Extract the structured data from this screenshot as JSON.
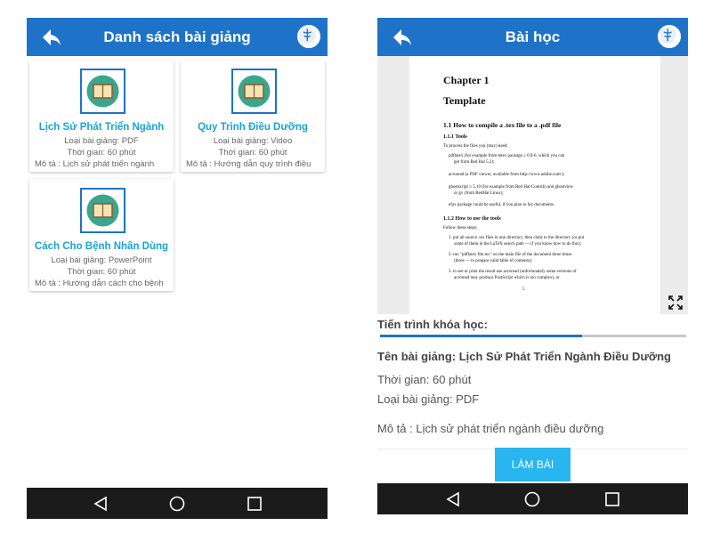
{
  "left_screen": {
    "title": "Danh sách bài giảng",
    "cards": [
      {
        "title": "Lịch Sử Phát Triển Ngành",
        "type": "Loại bài giảng: PDF",
        "duration": "Thời gian: 60 phút",
        "description": "Mô tả : Lịch sử phát triển ngành"
      },
      {
        "title": "Quy Trình Điều Dưỡng",
        "type": "Loại bài giảng: Video",
        "duration": "Thời gian: 60 phút",
        "description": "Mô tả : Hướng dẫn quy trình điều"
      },
      {
        "title": "Cách Cho Bệnh Nhân Dùng",
        "type": "Loại bài giảng: PowerPoint",
        "duration": "Thời gian: 60 phút",
        "description": "Mô tả : Hướng dẫn cách cho bệnh"
      }
    ]
  },
  "right_screen": {
    "title": "Bài học",
    "document": {
      "chapter": "Chapter 1",
      "heading": "Template",
      "section": "1.1   How to compile a .tex file to a .pdf file",
      "subsection1": "1.1.1   Tools",
      "intro": "To process the files you (may) need:",
      "tools": [
        "pdflatex (for example from tetex package ≥ 0.9-6, which you can",
        "get from Red Hat 5.2);",
        "acroread (a PDF viewer, available from http://www.adobe.com/);",
        "ghostscript ≥ 5.10 (for example from Red Hat Contrib) and ghostview",
        "or gv (from RedHat Linux);",
        "efax package could be useful, if you plan to fax documents."
      ],
      "subsection2": "1.1.2   How to use the tools",
      "steps_intro": "Follow these steps:",
      "steps": [
        "1. put all source .tex files in one directory, then chdir to the directory (or put",
        "some of them in the LaTeX search path — if you know how to do this);",
        "2. run \"pdflatex file.tex\" on the main file of the document three times",
        "(three — to prepare valid table of contents);",
        "3. to see or print the result use acroread (unfortunately some versions of",
        "acroread may produce PostScript which is too complex), or"
      ],
      "page_number": "5"
    },
    "progress_label": "Tiến trình khóa học:",
    "progress_fraction": 0.66,
    "lesson_name": "Tên bài giảng: Lịch Sử Phát Triển Ngành Điều Dưỡng",
    "duration": "Thời gian: 60 phút",
    "type": "Loại bài giảng: PDF",
    "description": "Mô tả : Lịch sử phát triển ngành điều dưỡng",
    "button_label": "LÀM BÀI"
  },
  "colors": {
    "primary": "#1e73c8",
    "accent": "#19a3dc",
    "button": "#28b5f0",
    "navbar": "#1b1b1b"
  },
  "icons": [
    "back-arrow-icon",
    "logo-icon",
    "book-icon",
    "expand-icon",
    "nav-back-icon",
    "nav-home-icon",
    "nav-recents-icon"
  ]
}
